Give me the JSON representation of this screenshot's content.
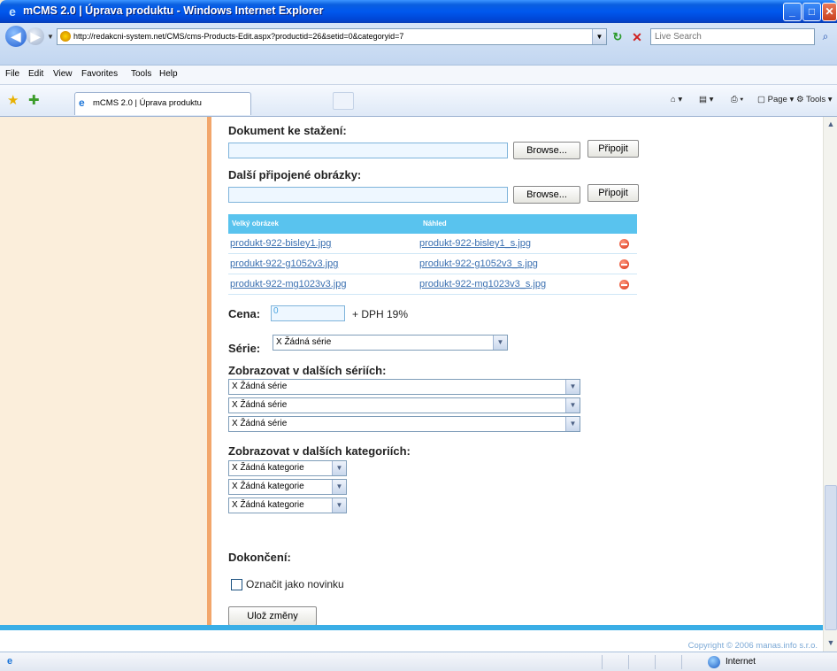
{
  "window": {
    "app_icon": "ie-logo-icon",
    "title": "mCMS 2.0 | Úprava produktu - Windows Internet Explorer",
    "minimize": "_",
    "maximize": "□",
    "close": "✕"
  },
  "address_bar": {
    "url": "http://redakcni-system.net/CMS/cms-Products-Edit.aspx?productid=26&setid=0&categoryid=7",
    "search_placeholder": "Live Search"
  },
  "menu": [
    "File",
    "Edit",
    "View",
    "Favorites",
    "Tools",
    "Help"
  ],
  "tabs": {
    "active_title": "mCMS 2.0 | Úprava produktu",
    "commands": [
      "Page",
      "Tools"
    ]
  },
  "form": {
    "download_section": "Dokument ke stažení:",
    "images_section": "Další připojené obrázky:",
    "browse_label": "Browse...",
    "attach_label": "Připojit",
    "table": {
      "headers": [
        "Velký obrázek",
        "Náhled"
      ],
      "rows": [
        {
          "large": "produkt-922-bisley1.jpg",
          "thumb": "produkt-922-bisley1_s.jpg"
        },
        {
          "large": "produkt-922-g1052v3.jpg",
          "thumb": "produkt-922-g1052v3_s.jpg"
        },
        {
          "large": "produkt-922-mg1023v3.jpg",
          "thumb": "produkt-922-mg1023v3_s.jpg"
        }
      ]
    },
    "price_label": "Cena:",
    "price_value": "0",
    "vat_label": "+ DPH 19%",
    "series_label": "Série:",
    "series_value": "X Žádná série",
    "other_series_label": "Zobrazovat v dalších sériích:",
    "other_series": [
      "X Žádná série",
      "X Žádná série",
      "X Žádná série"
    ],
    "other_categories_label": "Zobrazovat v dalších kategoriích:",
    "other_categories": [
      "X Žádná kategorie",
      "X Žádná kategorie",
      "X Žádná kategorie"
    ],
    "finish_label": "Dokončení:",
    "news_checkbox_label": "Označit jako novinku",
    "news_checked": false,
    "save_label": "Ulož změny"
  },
  "footer": {
    "copyright": "Copyright © 2006 manas.info s.r.o."
  },
  "status": {
    "zone": "Internet"
  }
}
